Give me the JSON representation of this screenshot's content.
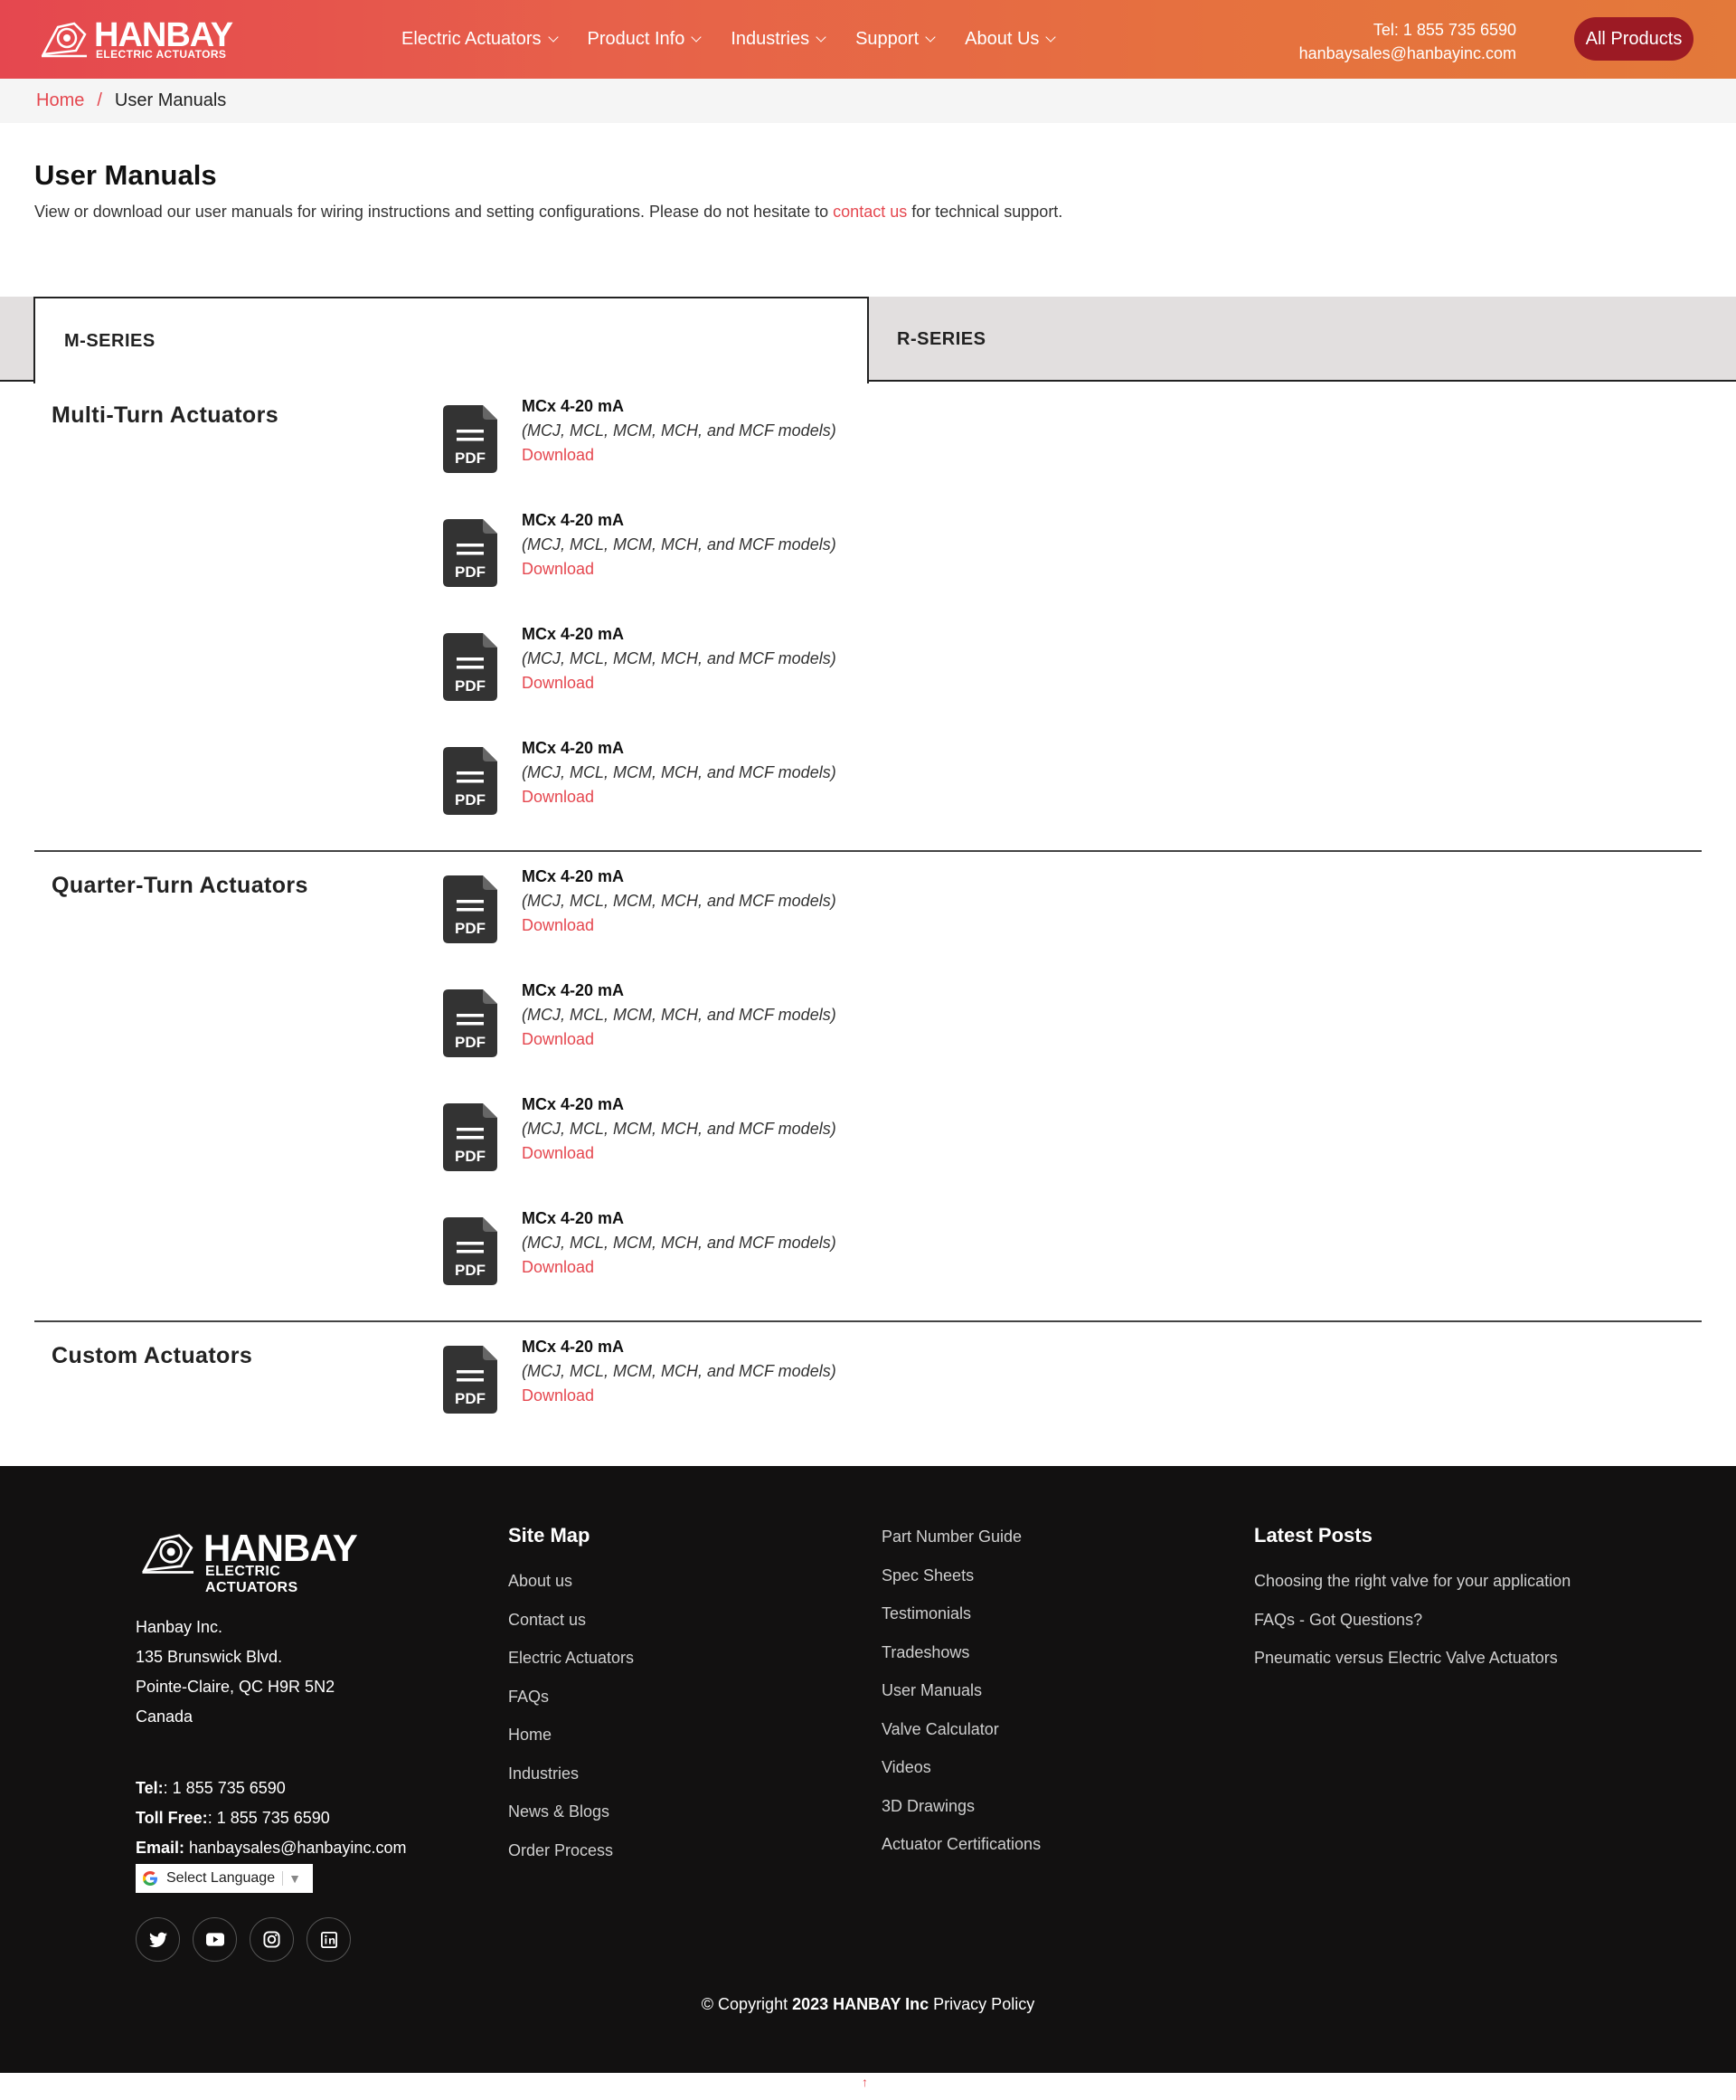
{
  "brand": {
    "name": "HANBAY",
    "tagline": "ELECTRIC ACTUATORS",
    "accent": "#e5474f",
    "button_color": "#9c1a24"
  },
  "header": {
    "nav": [
      {
        "label": "Electric Actuators",
        "icon": "chevron-down-icon"
      },
      {
        "label": "Product Info",
        "icon": "chevron-down-icon"
      },
      {
        "label": "Industries",
        "icon": "chevron-down-icon"
      },
      {
        "label": "Support",
        "icon": "chevron-down-icon"
      },
      {
        "label": "About Us",
        "icon": "chevron-down-icon"
      }
    ],
    "phone": "Tel: 1 855 735 6590",
    "email": "hanbaysales@hanbayinc.com",
    "cta": "All Products"
  },
  "breadcrumb": {
    "home": "Home",
    "separator": "/",
    "current": "User Manuals"
  },
  "intro": {
    "title": "User Manuals",
    "text_before": "View or download our user manuals for wiring instructions and setting configurations. Please do not hesitate to ",
    "link": "contact us",
    "text_after": " for technical support."
  },
  "tabs": [
    {
      "label": "M-SERIES",
      "active": true
    },
    {
      "label": "R-SERIES",
      "active": false
    }
  ],
  "sections": [
    {
      "title": "Multi-Turn Actuators",
      "manuals": [
        {
          "title": "MCx 4-20 mA",
          "models": "(MCJ, MCL, MCM, MCH, and MCF models)",
          "action": "Download"
        },
        {
          "title": "MCx 4-20 mA",
          "models": "(MCJ, MCL, MCM, MCH, and MCF models)",
          "action": "Download"
        },
        {
          "title": "MCx 4-20 mA",
          "models": "(MCJ, MCL, MCM, MCH, and MCF models)",
          "action": "Download"
        },
        {
          "title": "MCx 4-20 mA",
          "models": "(MCJ, MCL, MCM, MCH, and MCF models)",
          "action": "Download"
        }
      ]
    },
    {
      "title": "Quarter-Turn Actuators",
      "manuals": [
        {
          "title": "MCx 4-20 mA",
          "models": "(MCJ, MCL, MCM, MCH, and MCF models)",
          "action": "Download"
        },
        {
          "title": "MCx 4-20 mA",
          "models": "(MCJ, MCL, MCM, MCH, and MCF models)",
          "action": "Download"
        },
        {
          "title": "MCx 4-20 mA",
          "models": "(MCJ, MCL, MCM, MCH, and MCF models)",
          "action": "Download"
        },
        {
          "title": "MCx 4-20 mA",
          "models": "(MCJ, MCL, MCM, MCH, and MCF models)",
          "action": "Download"
        }
      ]
    },
    {
      "title": "Custom Actuators",
      "manuals": [
        {
          "title": "MCx 4-20 mA",
          "models": "(MCJ, MCL, MCM, MCH, and MCF models)",
          "action": "Download"
        }
      ]
    }
  ],
  "pdf_label": "PDF",
  "footer": {
    "address": [
      "Hanbay Inc.",
      "135 Brunswick Blvd.",
      "Pointe-Claire, QC H9R 5N2",
      "Canada"
    ],
    "tel_label": "Tel:",
    "tel": ": 1 855 735 6590",
    "tollfree_label": "Toll Free:",
    "tollfree": ": 1 855 735 6590",
    "email_label": "Email:",
    "email": " hanbaysales@hanbayinc.com",
    "language": "Select Language",
    "social": [
      "twitter-icon",
      "youtube-icon",
      "instagram-icon",
      "linkedin-icon"
    ],
    "sitemap_title": "Site Map",
    "sitemap": [
      "About us",
      "Contact us",
      "Electric Actuators",
      "FAQs",
      "Home",
      "Industries",
      "News & Blogs",
      "Order Process"
    ],
    "more_links": [
      "Part Number Guide",
      "Spec Sheets",
      "Testimonials",
      "Tradeshows",
      "User Manuals",
      "Valve Calculator",
      "Videos",
      "3D Drawings",
      "Actuator Certifications"
    ],
    "posts_title": "Latest Posts",
    "posts": [
      "Choosing the right valve for your application",
      "FAQs - Got Questions?",
      "Pneumatic versus Electric Valve Actuators"
    ],
    "copyright_prefix": "© Copyright ",
    "copyright_bold": "2023 HANBAY Inc",
    "privacy": " Privacy Policy"
  },
  "back_to_top": "↑"
}
